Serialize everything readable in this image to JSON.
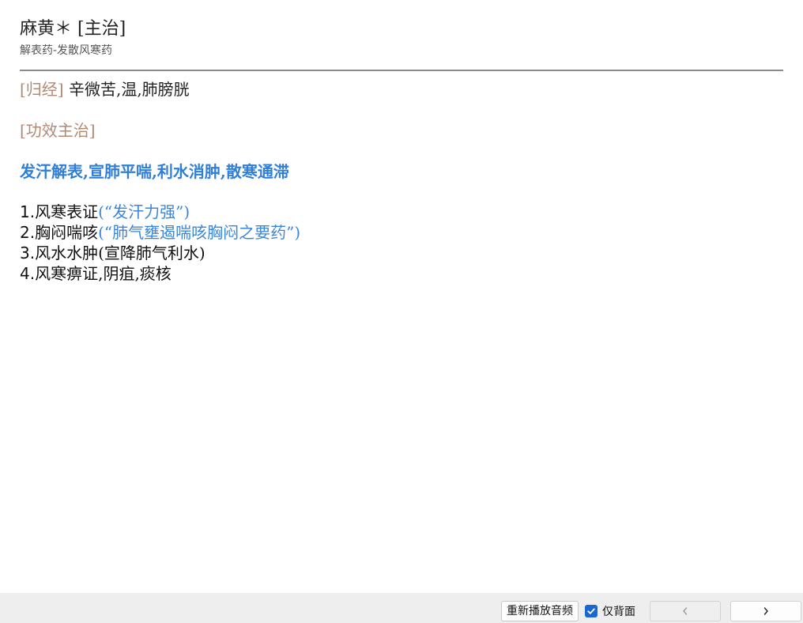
{
  "header": {
    "title": "麻黄＊ [主治]",
    "subtitle": "解表药-发散风寒药"
  },
  "content": {
    "meridian_tag": "[归经]",
    "meridian_text": " 辛微苦,温,肺膀胱",
    "efficacy_tag": "[功效主治]",
    "efficacy_key": "发汗解表,宣肺平喘,利水消肿,散寒通滞",
    "items": [
      {
        "num": "1.",
        "text": "风寒表证",
        "note": "(“发汗力强”)"
      },
      {
        "num": "2.",
        "text": "胸闷喘咳",
        "note": "(“肺气壅遏喘咳胸闷之要药”)"
      },
      {
        "num": "3.",
        "text": "风水水肿(宣降肺气利水)",
        "note": ""
      },
      {
        "num": "4.",
        "text": "风寒痹证,阴疽,痰核",
        "note": ""
      }
    ]
  },
  "toolbar": {
    "replay_label": "重新播放音频",
    "back_only_label": "仅背面",
    "back_only_checked": true,
    "prev_icon": "chevron-left-icon",
    "next_icon": "chevron-right-icon"
  },
  "colors": {
    "tag": "#b08a74",
    "key": "#2f7fd8",
    "note": "#3a86db",
    "checkbox": "#1967d2"
  }
}
